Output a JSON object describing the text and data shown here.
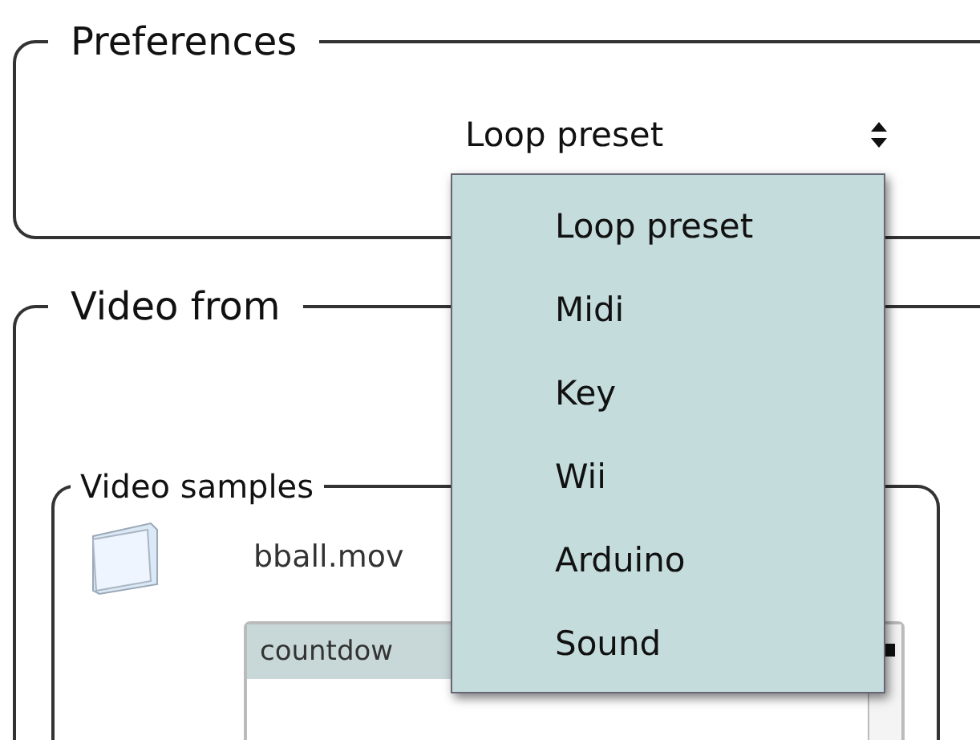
{
  "preferences": {
    "title": "Preferences",
    "select": {
      "value": "Loop preset",
      "expanded": true
    }
  },
  "dropdown_menu": {
    "items": [
      {
        "label": "Loop preset"
      },
      {
        "label": "Midi"
      },
      {
        "label": "Key"
      },
      {
        "label": "Wii"
      },
      {
        "label": "Arduino"
      },
      {
        "label": "Sound"
      }
    ]
  },
  "video_from": {
    "title": "Video from",
    "video_samples": {
      "title": "Video samples",
      "file": {
        "name": "bball.mov"
      },
      "list": {
        "header": "countdow"
      }
    }
  }
}
